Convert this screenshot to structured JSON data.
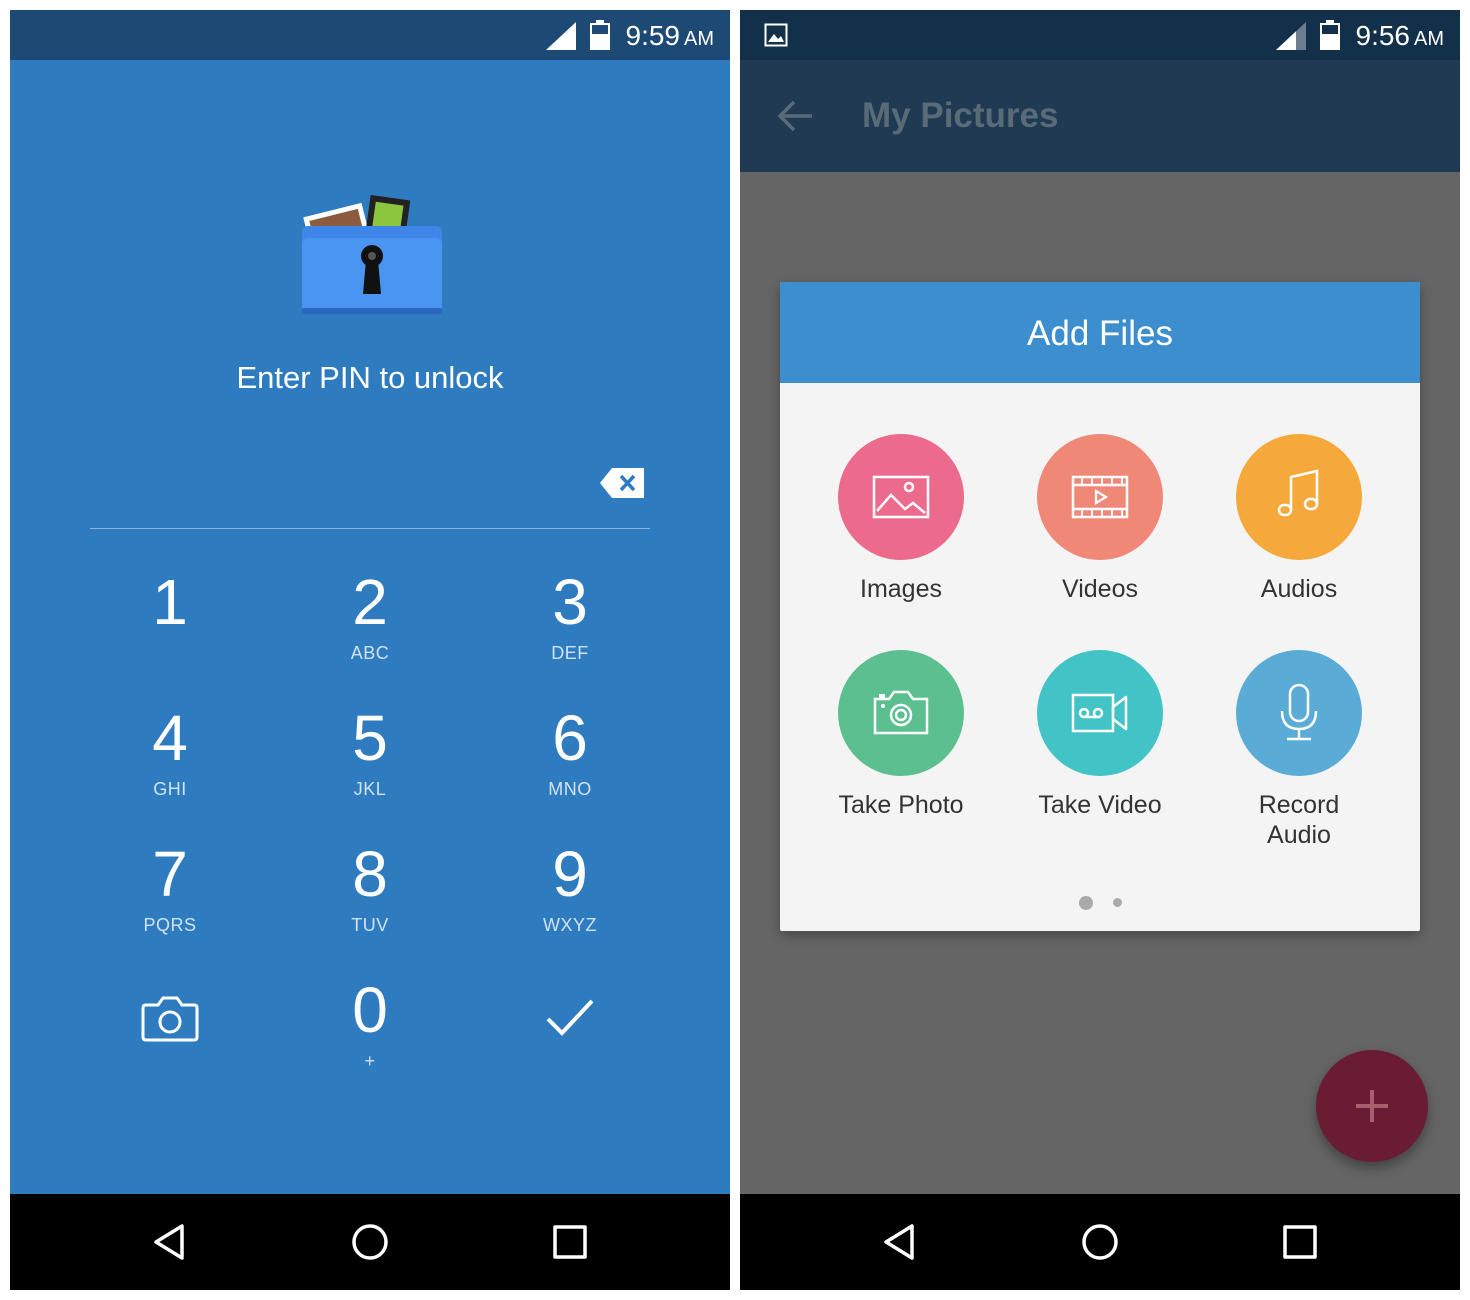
{
  "left_screen": {
    "status_bar": {
      "time": "9:59",
      "ampm": "AM"
    },
    "prompt": "Enter PIN to unlock",
    "keypad": {
      "keys": [
        {
          "digit": "1",
          "letters": ""
        },
        {
          "digit": "2",
          "letters": "ABC"
        },
        {
          "digit": "3",
          "letters": "DEF"
        },
        {
          "digit": "4",
          "letters": "GHI"
        },
        {
          "digit": "5",
          "letters": "JKL"
        },
        {
          "digit": "6",
          "letters": "MNO"
        },
        {
          "digit": "7",
          "letters": "PQRS"
        },
        {
          "digit": "8",
          "letters": "TUV"
        },
        {
          "digit": "9",
          "letters": "WXYZ"
        },
        {
          "digit": "0",
          "letters": "+"
        }
      ],
      "camera_icon": "camera-icon",
      "confirm_icon": "checkmark-icon",
      "backspace_icon": "backspace-icon"
    },
    "nav_bar": [
      "back-triangle-icon",
      "home-circle-icon",
      "recents-square-icon"
    ]
  },
  "right_screen": {
    "status_bar": {
      "time": "9:56",
      "ampm": "AM",
      "notification_icon": "gallery-icon"
    },
    "app_bar": {
      "title": "My Pictures",
      "back_icon": "back-arrow-icon"
    },
    "dialog": {
      "title": "Add Files",
      "items": [
        {
          "label": "Images",
          "icon": "image-icon",
          "color": "#ec6b8c"
        },
        {
          "label": "Videos",
          "icon": "film-icon",
          "color": "#f08878"
        },
        {
          "label": "Audios",
          "icon": "music-note-icon",
          "color": "#f4a93a"
        },
        {
          "label": "Take Photo",
          "icon": "camera-icon",
          "color": "#5cbf8f"
        },
        {
          "label": "Take Video",
          "icon": "video-camera-icon",
          "color": "#42c3c5"
        },
        {
          "label": "Record Audio",
          "icon": "microphone-icon",
          "color": "#5aacd6"
        }
      ],
      "pager": {
        "pages": 2,
        "current": 1
      }
    },
    "fab": {
      "icon": "plus-icon",
      "color": "#6a1c35"
    },
    "nav_bar": [
      "back-triangle-icon",
      "home-circle-icon",
      "recents-square-icon"
    ]
  }
}
